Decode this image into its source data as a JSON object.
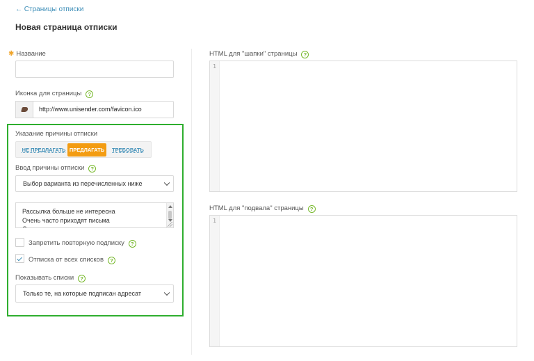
{
  "header": {
    "back_link": "← Страницы отписки",
    "page_title": "Новая страница отписки"
  },
  "form": {
    "name_label": "Название",
    "name_value": "",
    "icon_label": "Иконка для страницы",
    "icon_url": "http://www.unisender.com/favicon.ico",
    "reason": {
      "section_label": "Указание причины отписки",
      "options": [
        "НЕ ПРЕДЛАГАТЬ",
        "ПРЕДЛАГАТЬ",
        "ТРЕБОВАТЬ"
      ],
      "selected": "ПРЕДЛАГАТЬ",
      "input_label": "Ввод причины отписки",
      "input_select_value": "Выбор варианта из перечисленных ниже",
      "reasons_text": [
        "Рассылка больше не интересна",
        "Очень часто приходят письма",
        "С"
      ]
    },
    "checkboxes": [
      {
        "label": "Запретить повторную подписку",
        "checked": false
      },
      {
        "label": "Отписка от всех списков",
        "checked": true
      }
    ],
    "lists": {
      "label": "Показывать списки",
      "select_value": "Только те, на которые подписан адресат"
    }
  },
  "editors": {
    "header_label": "HTML для \"шапки\" страницы",
    "header_line": "1",
    "footer_label": "HTML для \"подвала\" страницы",
    "footer_line": "1"
  },
  "icons": {
    "help": "?",
    "back": "arrow-left-icon",
    "favicon": "favicon-image",
    "select": "chevron-down-icon",
    "check": "checkmark-icon"
  },
  "colors": {
    "link": "#3f8fb8",
    "accent_orange": "#f39c12",
    "help_green": "#76b82a",
    "highlight_frame": "#2eae2e"
  }
}
